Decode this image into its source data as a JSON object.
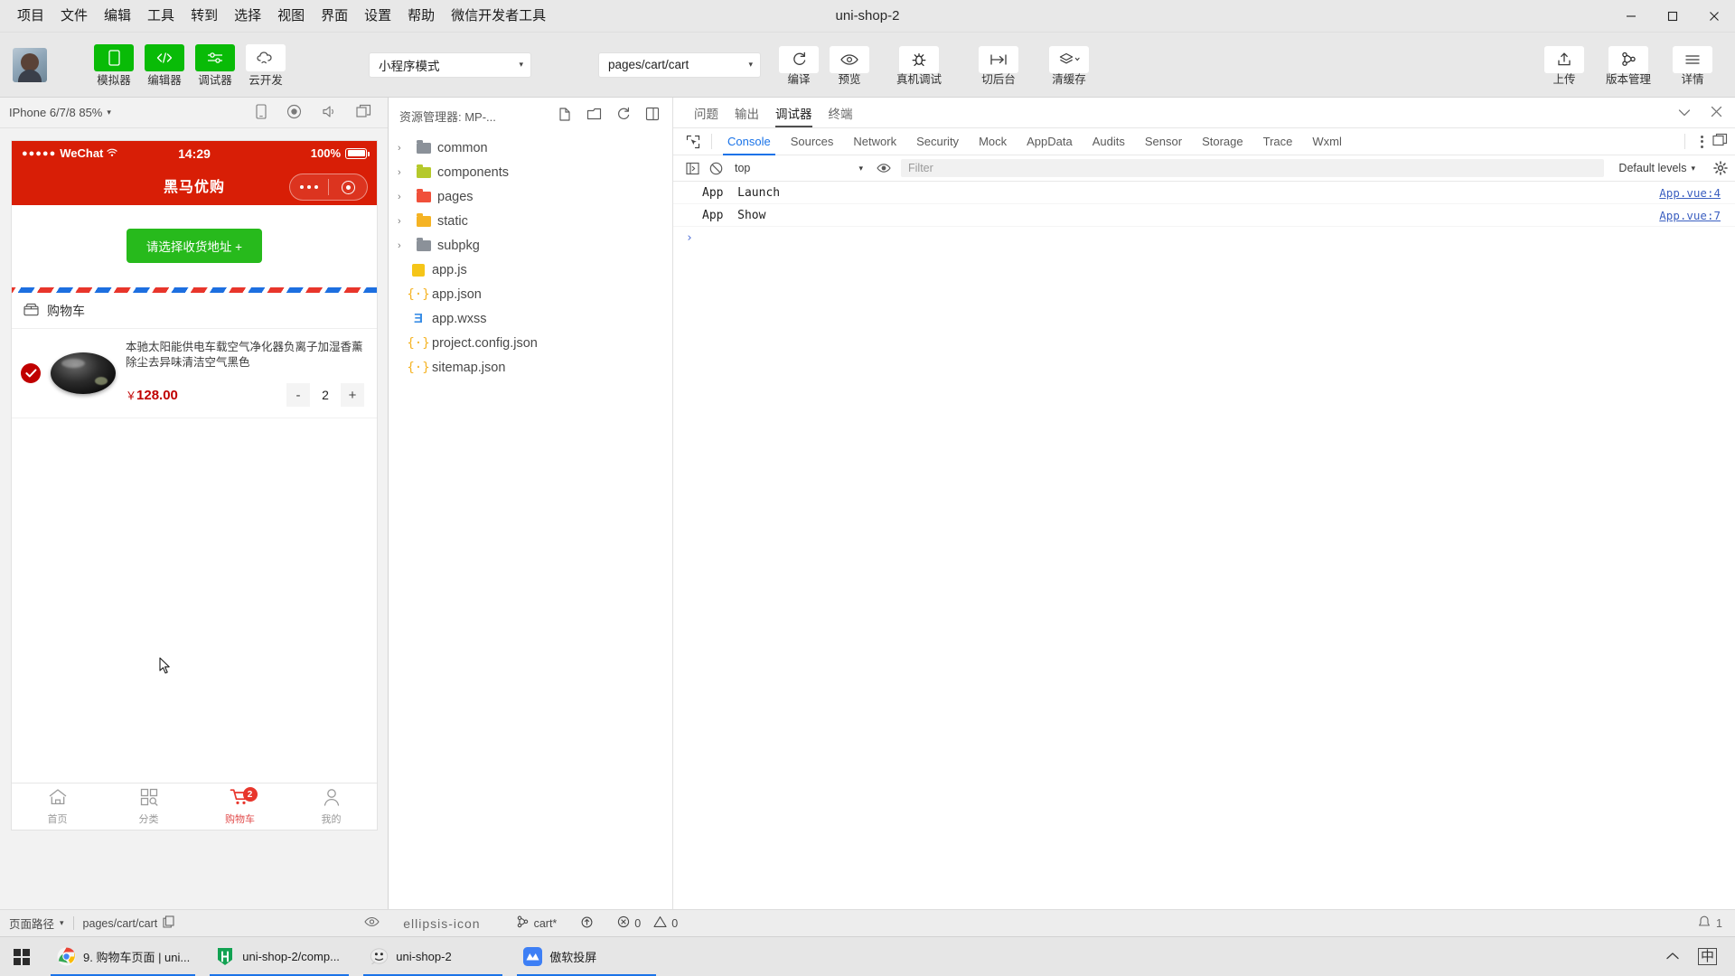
{
  "window": {
    "title": "uni-shop-2",
    "controls": {
      "minimize": "minimize-icon",
      "maximize": "maximize-icon",
      "close": "close-icon"
    }
  },
  "menubar": {
    "items": [
      "项目",
      "文件",
      "编辑",
      "工具",
      "转到",
      "选择",
      "视图",
      "界面",
      "设置",
      "帮助",
      "微信开发者工具"
    ]
  },
  "toolbar": {
    "buttons": [
      {
        "label": "模拟器",
        "icon": "phone-icon",
        "active": true
      },
      {
        "label": "编辑器",
        "icon": "code-icon",
        "active": true
      },
      {
        "label": "调试器",
        "icon": "sliders-icon",
        "active": true
      },
      {
        "label": "云开发",
        "icon": "cloud-icon",
        "active": false
      }
    ],
    "mode_select": {
      "value": "小程序模式",
      "caret": "▾"
    },
    "page_select": {
      "value": "pages/cart/cart",
      "caret": "▾"
    },
    "compile": {
      "label": "编译",
      "icon": "refresh-icon"
    },
    "preview": {
      "label": "预览",
      "icon": "eye-icon"
    },
    "real_debug": {
      "label": "真机调试",
      "icon": "bug-icon"
    },
    "background": {
      "label": "切后台",
      "icon": "switch-icon"
    },
    "clear_cache": {
      "label": "清缓存",
      "icon": "layers-icon",
      "caret": "▾"
    },
    "upload": {
      "label": "上传",
      "icon": "upload-icon"
    },
    "version": {
      "label": "版本管理",
      "icon": "git-branch-icon"
    },
    "details": {
      "label": "详情",
      "icon": "hamburger-icon"
    }
  },
  "simulator": {
    "device": "IPhone 6/7/8 85%",
    "caret": "▾",
    "icons": [
      "rotate-device-icon",
      "record-icon",
      "volume-icon",
      "multi-window-icon"
    ],
    "phone": {
      "status_bar": {
        "carrier": "WeChat",
        "dots": "●●●●●",
        "wifi": "wifi-icon",
        "time": "14:29",
        "battery_pct": "100%"
      },
      "nav_title": "黑马优购",
      "address_button": "请选择收货地址 +",
      "cart_section_label": "购物车",
      "cart_section_icon": "store-icon",
      "items": [
        {
          "selected": true,
          "title": "本驰太阳能供电车载空气净化器负离子加湿香薰 除尘去异味清洁空气黑色",
          "currency": "￥",
          "price": "128.00",
          "qty": "2",
          "minus": "-",
          "plus": "+",
          "thumb": "air-purifier-photo"
        }
      ],
      "tabbar": [
        {
          "label": "首页",
          "icon": "home-icon",
          "active": false,
          "badge": ""
        },
        {
          "label": "分类",
          "icon": "category-icon",
          "active": false,
          "badge": ""
        },
        {
          "label": "购物车",
          "icon": "cart-icon",
          "active": true,
          "badge": "2"
        },
        {
          "label": "我的",
          "icon": "user-icon",
          "active": false,
          "badge": ""
        }
      ]
    }
  },
  "explorer": {
    "title": "资源管理器: MP-...",
    "actions": [
      "new-file-icon",
      "new-folder-icon",
      "refresh-icon",
      "collapse-all-icon"
    ],
    "tree": [
      {
        "name": "common",
        "type": "folder",
        "chev": "›",
        "color": "#8b9199"
      },
      {
        "name": "components",
        "type": "folder",
        "chev": "›",
        "color": "#b5c92b"
      },
      {
        "name": "pages",
        "type": "folder",
        "chev": "›",
        "color": "#f0503a"
      },
      {
        "name": "static",
        "type": "folder",
        "chev": "›",
        "color": "#f5b324"
      },
      {
        "name": "subpkg",
        "type": "folder",
        "chev": "›",
        "color": "#8b9199"
      },
      {
        "name": "app.js",
        "type": "js",
        "chev": "",
        "color": "#f5c518"
      },
      {
        "name": "app.json",
        "type": "json",
        "chev": "",
        "color": "#f5b324"
      },
      {
        "name": "app.wxss",
        "type": "wxss",
        "chev": "",
        "color": "#3a8ee6"
      },
      {
        "name": "project.config.json",
        "type": "json",
        "chev": "",
        "color": "#f5b324"
      },
      {
        "name": "sitemap.json",
        "type": "json",
        "chev": "",
        "color": "#f5b324"
      }
    ]
  },
  "debugger": {
    "panel_tabs": [
      {
        "label": "问题",
        "active": false
      },
      {
        "label": "输出",
        "active": false
      },
      {
        "label": "调试器",
        "active": true
      },
      {
        "label": "终端",
        "active": false
      }
    ],
    "panel_actions": {
      "collapse": "chevron-down-icon",
      "close": "close-icon"
    },
    "devtools_tabs": [
      {
        "label": "Console",
        "active": true
      },
      {
        "label": "Sources",
        "active": false
      },
      {
        "label": "Network",
        "active": false
      },
      {
        "label": "Security",
        "active": false
      },
      {
        "label": "Mock",
        "active": false
      },
      {
        "label": "AppData",
        "active": false
      },
      {
        "label": "Audits",
        "active": false
      },
      {
        "label": "Sensor",
        "active": false
      },
      {
        "label": "Storage",
        "active": false
      },
      {
        "label": "Trace",
        "active": false
      },
      {
        "label": "Wxml",
        "active": false
      }
    ],
    "inspect_icon": "inspect-element-icon",
    "more_icon": "kebab-menu-icon",
    "dock_icon": "dock-panel-icon",
    "filter_bar": {
      "sidebar_icon": "console-sidebar-icon",
      "clear_icon": "clear-console-icon",
      "context": "top",
      "context_caret": "▾",
      "eye_icon": "live-expression-icon",
      "filter_placeholder": "Filter",
      "levels": "Default levels",
      "levels_caret": "▾",
      "settings_icon": "gear-icon"
    },
    "console_rows": [
      {
        "message": "App  Launch",
        "source": "App.vue:4"
      },
      {
        "message": "App  Show",
        "source": "App.vue:7"
      }
    ],
    "prompt": "›"
  },
  "statusbar": {
    "path_label": "页面路径",
    "path_caret": "▾",
    "path_value": "pages/cart/cart",
    "copy_icon": "copy-icon",
    "eye_icon": "eye-icon",
    "more_icon": "ellipsis-icon",
    "branch_icon": "git-branch-icon",
    "branch": "cart*",
    "sync_icon": "sync-icon",
    "errors_icon": "error-icon",
    "errors": "0",
    "warnings_icon": "warning-icon",
    "warnings": "0",
    "bell_icon": "bell-icon",
    "bell_count": "1"
  },
  "taskbar": {
    "start": "windows-start-icon",
    "items": [
      {
        "label": "9. 购物车页面 | uni...",
        "icon": "chrome-icon",
        "active": true
      },
      {
        "label": "uni-shop-2/comp...",
        "icon": "hbuilder-icon",
        "active": true
      },
      {
        "label": "uni-shop-2",
        "icon": "wechat-devtools-icon",
        "active": true
      },
      {
        "label": "傲软投屏",
        "icon": "apowermirror-icon",
        "active": true
      }
    ],
    "tray": {
      "chevron": "^",
      "ime": "中"
    }
  }
}
